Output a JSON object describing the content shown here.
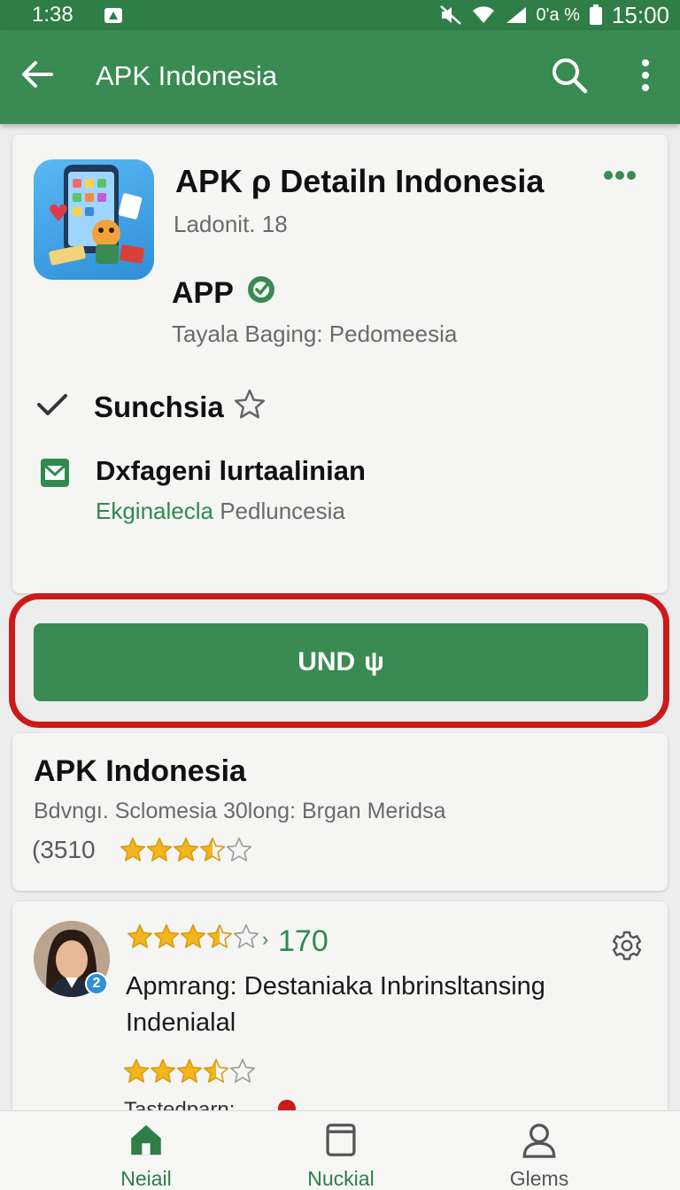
{
  "status_bar": {
    "time_left": "1:38",
    "battery_pct": "0'a %",
    "time_right": "15:00"
  },
  "app_bar": {
    "title": "APK Indonesia",
    "icons": [
      "back-arrow-icon",
      "search-icon",
      "more-vert-icon"
    ]
  },
  "app_card": {
    "name": "APK ρ Detailn Indonesia",
    "version": "Ladonit. 18",
    "type_label": "APP",
    "rating_line": "Tayala Baging: Pedomeesia",
    "row1_label": "Sunchsia",
    "row2_title": "Dxfageni lurtaalinian",
    "row2_sub_green": "Ekginalecla",
    "row2_sub_rest": " Pedluncesia"
  },
  "install_button": {
    "label": "UND",
    "glyph": "ψ"
  },
  "info_card": {
    "title": "APK Indonesia",
    "subtitle": "Bdvngı. Sclomesia  30long: Brgan Meridsa",
    "count": "(3510",
    "rating": 3.5
  },
  "review_card": {
    "stars": 3.5,
    "arrow": "›",
    "count": "170",
    "text": "Apmrang: Destaniaka Inbrinsltansing Indenialal",
    "inner_stars": 3.5,
    "footer": "Tastedparn: .",
    "badge_num": "2"
  },
  "bottom_nav": {
    "items": [
      {
        "label": "Neiail",
        "icon": "home-icon",
        "active": true
      },
      {
        "label": "Nuckial",
        "icon": "tablet-icon",
        "active": false
      },
      {
        "label": "Glems",
        "icon": "person-icon",
        "active": false
      }
    ]
  },
  "colors": {
    "primary": "#3a8a53",
    "status_bar": "#2f7d47",
    "highlight": "#cc1a1a",
    "star": "#f2b51c"
  }
}
